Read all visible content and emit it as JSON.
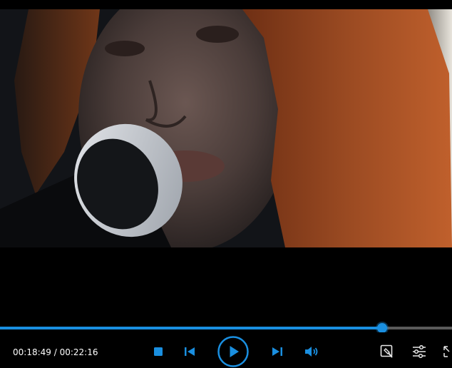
{
  "player": {
    "time_current": "00:18:49",
    "time_total": "00:22:16",
    "time_separator": " / ",
    "progress": 0.8447
  },
  "icons": {
    "stop": "stop-icon",
    "previous": "skip-previous-icon",
    "play": "play-icon",
    "next": "skip-next-icon",
    "volume": "volume-icon",
    "tools": "screenshot-tools-icon",
    "settings": "equalizer-settings-icon",
    "fullscreen": "fullscreen-icon"
  },
  "colors": {
    "accent": "#1a8fe0",
    "background": "#000000",
    "track": "#5a5a5a"
  }
}
